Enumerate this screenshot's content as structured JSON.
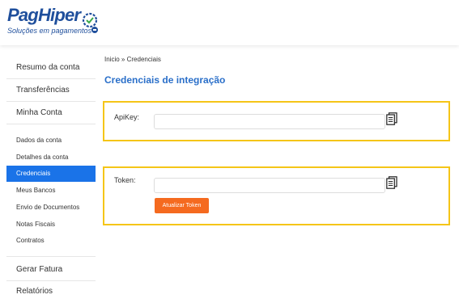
{
  "brand": {
    "name": "PagHiper",
    "tagline": "Soluções em pagamentos",
    "colors": {
      "primary": "#1f4f9c",
      "accent_green": "#3aa84a"
    }
  },
  "sidebar": {
    "top_items": [
      {
        "label": "Resumo da conta"
      },
      {
        "label": "Transferências"
      },
      {
        "label": "Minha Conta"
      }
    ],
    "sub_items": [
      {
        "label": "Dados da conta",
        "active": false
      },
      {
        "label": "Detalhes da conta",
        "active": false
      },
      {
        "label": "Credenciais",
        "active": true
      },
      {
        "label": "Meus Bancos",
        "active": false
      },
      {
        "label": "Envio de Documentos",
        "active": false
      },
      {
        "label": "Notas Fiscais",
        "active": false
      },
      {
        "label": "Contratos",
        "active": false
      }
    ],
    "bottom_items": [
      {
        "label": "Gerar Fatura"
      },
      {
        "label": "Relatórios"
      }
    ]
  },
  "breadcrumb": {
    "home": "Inicio",
    "separator": "»",
    "current": "Credenciais"
  },
  "page": {
    "title": "Credenciais de integração"
  },
  "apikey": {
    "label": "ApiKey:",
    "value": "",
    "copy_icon": "copy-document-icon"
  },
  "token": {
    "label": "Token:",
    "value": "",
    "copy_icon": "copy-document-icon",
    "update_button": "Atualizar Token"
  },
  "colors": {
    "highlight_border": "#f5c518",
    "active_menu": "#1a73e8",
    "title": "#2a6fc9",
    "button": "#f56a1f"
  }
}
